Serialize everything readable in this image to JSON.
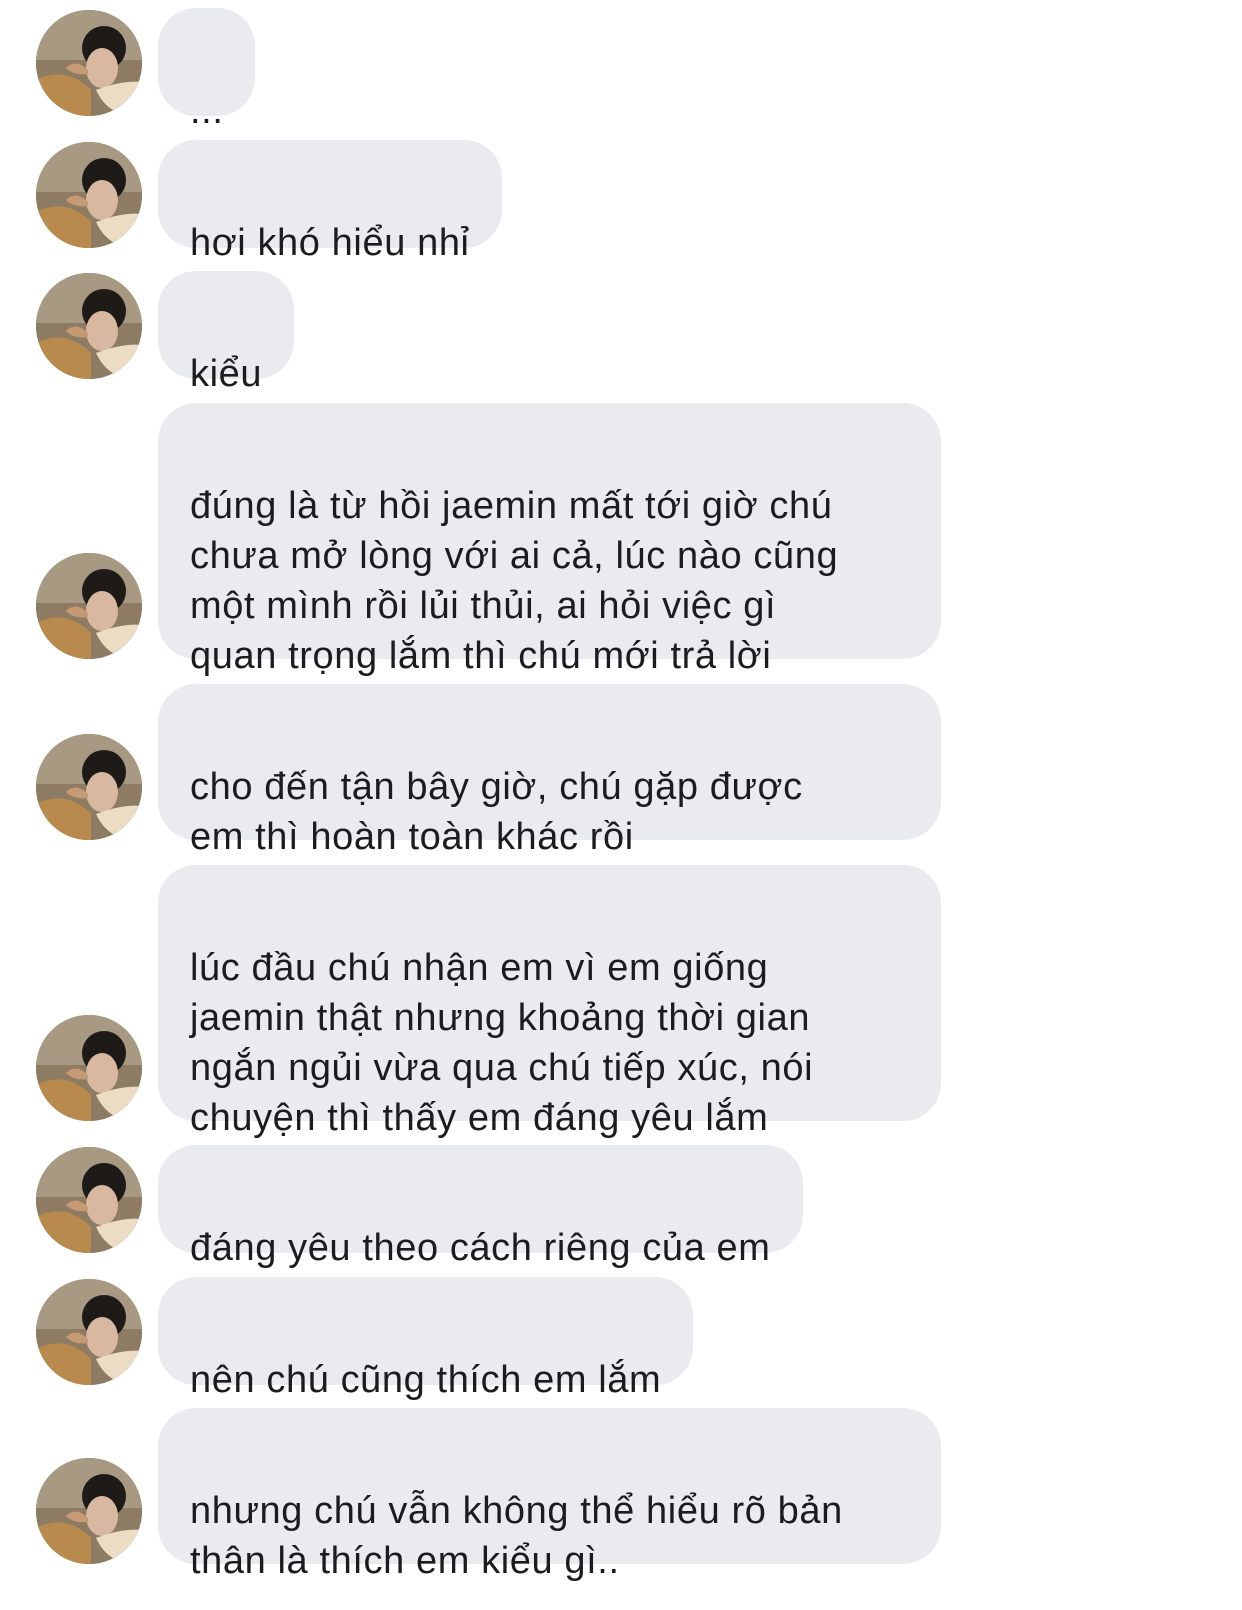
{
  "conversation": {
    "messages": [
      {
        "text": "..."
      },
      {
        "text": "hơi khó hiểu nhỉ"
      },
      {
        "text": "kiểu"
      },
      {
        "text": "đúng là từ hồi jaemin mất tới giờ chú\nchưa mở lòng với ai cả, lúc nào cũng\nmột mình rồi lủi thủi, ai hỏi việc gì\nquan trọng lắm thì chú mới trả lời"
      },
      {
        "text": "cho đến tận bây giờ, chú gặp được\nem thì hoàn toàn khác rồi"
      },
      {
        "text": "lúc đầu chú nhận em vì em giống\njaemin thật nhưng khoảng thời gian\nngắn ngủi vừa qua chú tiếp xúc, nói\nchuyện thì thấy em đáng yêu lắm"
      },
      {
        "text": "đáng yêu theo cách riêng của em"
      },
      {
        "text": "nên chú cũng thích em lắm"
      },
      {
        "text": "nhưng chú vẫn không thể hiểu rõ bản\nthân là thích em kiểu gì.."
      }
    ]
  },
  "colors": {
    "bubble": "#e9ebef",
    "text": "#1c1c1e",
    "background": "#ffffff"
  }
}
